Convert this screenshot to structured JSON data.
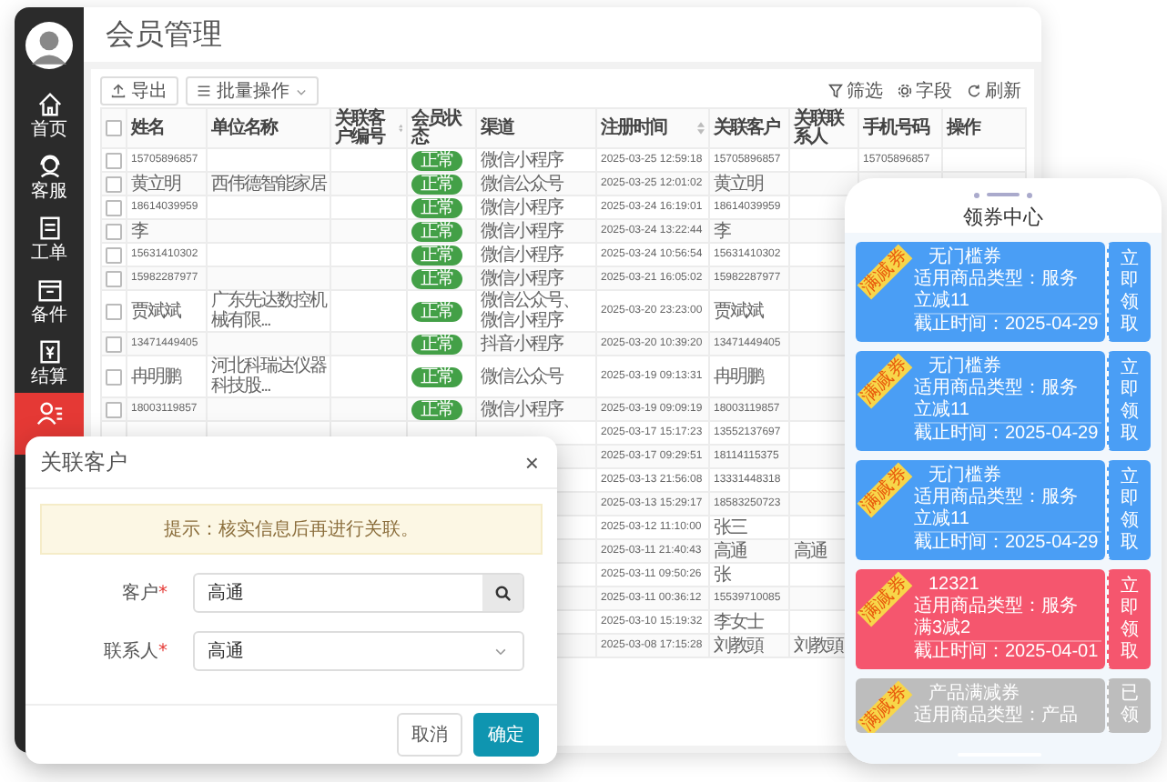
{
  "sidebar": {
    "items": [
      {
        "kind": "home",
        "label": "首页",
        "selected": false
      },
      {
        "kind": "service",
        "label": "客服",
        "selected": false
      },
      {
        "kind": "ticket",
        "label": "工单",
        "selected": false
      },
      {
        "kind": "parts",
        "label": "备件",
        "selected": false
      },
      {
        "kind": "settle",
        "label": "结算",
        "selected": false
      },
      {
        "kind": "member",
        "selected": true
      }
    ]
  },
  "page_title": "会员管理",
  "toolbar": {
    "left": [
      {
        "kind": "export",
        "label": "导出"
      },
      {
        "kind": "batch",
        "label": "批量操作"
      }
    ],
    "right": [
      {
        "kind": "filter",
        "label": "筛选"
      },
      {
        "kind": "fields",
        "label": "字段"
      },
      {
        "kind": "refresh",
        "label": "刷新"
      }
    ]
  },
  "table": {
    "all_checked": false,
    "columns": [
      {
        "label": "姓名"
      },
      {
        "label": "单位名称"
      },
      {
        "label": "关联客户编号",
        "sortable": true
      },
      {
        "label": "会员状态"
      },
      {
        "label": "渠道"
      },
      {
        "label": "注册时间",
        "sortable": true
      },
      {
        "label": "关联客户"
      },
      {
        "label": "关联联系人"
      },
      {
        "label": "手机号码"
      },
      {
        "label": "操作"
      }
    ],
    "rows": [
      {
        "checked": false,
        "name": "15705896857",
        "status": "正常",
        "channel": "微信小程序",
        "time": "2025-03-25 12:59:18",
        "customer": "15705896857",
        "phone": "15705896857"
      },
      {
        "checked": false,
        "name": "黄立明",
        "company": "西伟德智能家居",
        "status": "正常",
        "channel": "微信公众号",
        "time": "2025-03-25 12:01:02",
        "customer": "黄立明"
      },
      {
        "checked": false,
        "name": "18614039959",
        "status": "正常",
        "channel": "微信小程序",
        "time": "2025-03-24 16:19:01",
        "customer": "18614039959"
      },
      {
        "checked": false,
        "name": "李",
        "status": "正常",
        "channel": "微信小程序",
        "time": "2025-03-24 13:22:44",
        "customer": "李"
      },
      {
        "checked": false,
        "name": "15631410302",
        "status": "正常",
        "channel": "微信小程序",
        "time": "2025-03-24 10:56:54",
        "customer": "15631410302"
      },
      {
        "checked": false,
        "name": "15982287977",
        "status": "正常",
        "channel": "微信小程序",
        "time": "2025-03-21 16:05:02",
        "customer": "15982287977"
      },
      {
        "checked": false,
        "name": "贾斌斌",
        "company": "广东先达数控机械有限...",
        "status": "正常",
        "channel": "微信公众号、微信小程序",
        "time": "2025-03-20 23:23:00",
        "customer": "贾斌斌"
      },
      {
        "checked": false,
        "name": "13471449405",
        "status": "正常",
        "channel": "抖音小程序",
        "time": "2025-03-20 10:39:20",
        "customer": "13471449405"
      },
      {
        "checked": false,
        "name": "冉明鹏",
        "company": "河北科瑞达仪器科技股...",
        "status": "正常",
        "channel": "微信公众号",
        "time": "2025-03-19 09:13:31",
        "customer": "冉明鹏"
      },
      {
        "checked": false,
        "name": "18003119857",
        "status": "正常",
        "channel": "微信小程序",
        "time": "2025-03-19 09:09:19",
        "customer": "18003119857"
      },
      {
        "time": "2025-03-17 15:17:23",
        "customer": "13552137697"
      },
      {
        "time": "2025-03-17 09:29:51",
        "customer": "18114115375"
      },
      {
        "time": "2025-03-13 21:56:08",
        "customer": "13331448318"
      },
      {
        "time": "2025-03-13 15:29:17",
        "customer": "18583250723"
      },
      {
        "time": "2025-03-12 11:10:00",
        "customer": "张三"
      },
      {
        "time": "2025-03-11 21:40:43",
        "customer": "高通",
        "contact": "高通"
      },
      {
        "time": "2025-03-11 09:50:26",
        "customer": "张"
      },
      {
        "time": "2025-03-11 00:36:12",
        "customer": "15539710085"
      },
      {
        "time": "2025-03-10 15:19:32",
        "customer": "李女士"
      },
      {
        "time": "2025-03-08 17:15:28",
        "customer": "刘教頭",
        "contact": "刘教頭"
      }
    ]
  },
  "dialog": {
    "title": "关联客户",
    "close": "×",
    "notice": "提示：核实信息后再进行关联。",
    "fields": [
      {
        "kind": "search",
        "label": "客户",
        "required_mark": "*",
        "value": "高通"
      },
      {
        "kind": "select",
        "label": "联系人",
        "required_mark": "*",
        "value": "高通"
      }
    ],
    "buttons": [
      {
        "label": "取消",
        "primary": false
      },
      {
        "label": "确定",
        "primary": true
      }
    ]
  },
  "phone": {
    "title": "领券中心",
    "coupons": [
      {
        "ribbon": "满减券",
        "title": "无门槛券",
        "type": "适用商品类型：服务",
        "discount": "立减11",
        "deadline": "截止时间：2025-04-29",
        "action": "立即领取",
        "color": "#4a9ef5"
      },
      {
        "ribbon": "满减券",
        "title": "无门槛券",
        "type": "适用商品类型：服务",
        "discount": "立减11",
        "deadline": "截止时间：2025-04-29",
        "action": "立即领取",
        "color": "#4a9ef5"
      },
      {
        "ribbon": "满减券",
        "title": "无门槛券",
        "type": "适用商品类型：服务",
        "discount": "立减11",
        "deadline": "截止时间：2025-04-29",
        "action": "立即领取",
        "color": "#4a9ef5"
      },
      {
        "ribbon": "满减券",
        "title": "12321",
        "type": "适用商品类型：服务",
        "discount": "满3减2",
        "deadline": "截止时间：2025-04-01",
        "action": "立即领取",
        "color": "#f5566e"
      },
      {
        "ribbon": "满减券",
        "title": "产品满减券",
        "type": "适用商品类型：产品",
        "action": "已领",
        "color": "#bdbdbd"
      }
    ]
  }
}
